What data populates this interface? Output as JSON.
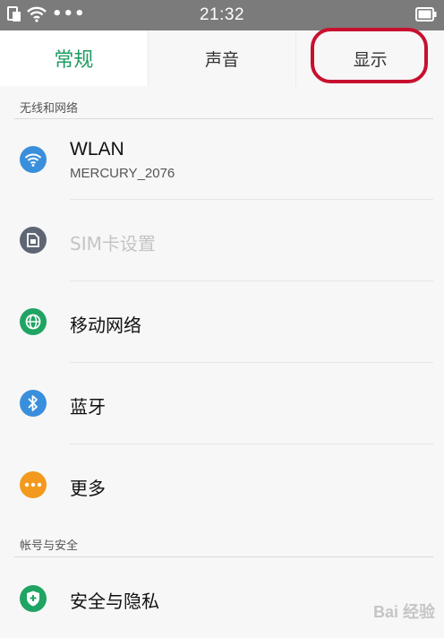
{
  "status_bar": {
    "time": "21:32",
    "more": "•••"
  },
  "tabs": [
    {
      "label": "常规",
      "active": true
    },
    {
      "label": "声音",
      "active": false
    },
    {
      "label": "显示",
      "active": false
    }
  ],
  "sections": [
    {
      "header": "无线和网络"
    },
    {
      "header": "帐号与安全"
    }
  ],
  "items": [
    {
      "title": "WLAN",
      "subtitle": "MERCURY_2076",
      "icon": "wifi-icon",
      "icon_color": "#3a8fdc"
    },
    {
      "title": "SIM卡设置",
      "icon": "sim-card-icon",
      "icon_color": "#5e6673",
      "disabled": true
    },
    {
      "title": "移动网络",
      "icon": "globe-icon",
      "icon_color": "#1fa463"
    },
    {
      "title": "蓝牙",
      "icon": "bluetooth-icon",
      "icon_color": "#3a8fdc"
    },
    {
      "title": "更多",
      "icon": "more-icon",
      "icon_color": "#f39a1e"
    },
    {
      "title": "安全与隐私",
      "icon": "shield-icon",
      "icon_color": "#1fa463"
    }
  ],
  "colors": {
    "accent": "#1f9b62",
    "highlight": "#c8102e",
    "status_bar": "#7b7b7b"
  }
}
